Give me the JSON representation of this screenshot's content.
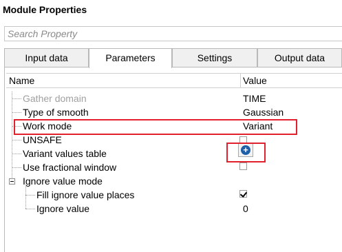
{
  "panel": {
    "title": "Module Properties"
  },
  "search": {
    "placeholder": "Search Property",
    "value": ""
  },
  "tabs": [
    {
      "label": "Input data",
      "active": false
    },
    {
      "label": "Parameters",
      "active": true
    },
    {
      "label": "Settings",
      "active": false
    },
    {
      "label": "Output data",
      "active": false
    }
  ],
  "grid": {
    "headers": {
      "name": "Name",
      "value": "Value"
    },
    "rows": [
      {
        "name": "Gather domain",
        "value": "TIME",
        "disabled": true
      },
      {
        "name": "Type of smooth",
        "value": "Gaussian"
      },
      {
        "name": "Work mode",
        "value": "Variant",
        "highlighted": true
      },
      {
        "name": "UNSAFE",
        "value_type": "checkbox",
        "checked": false
      },
      {
        "name": "Variant values table",
        "value_type": "add-button",
        "button_icon": "plus-icon",
        "highlighted": true
      },
      {
        "name": "Use fractional window",
        "value_type": "checkbox",
        "checked": false
      },
      {
        "name": "Ignore value mode",
        "group": true,
        "expanded": true
      },
      {
        "name": "Fill ignore value places",
        "value_type": "checkbox",
        "checked": true,
        "child": true
      },
      {
        "name": "Ignore value",
        "value": "0",
        "child": true
      }
    ]
  },
  "colors": {
    "highlight": "#e21f2b",
    "button_icon": "#1f5fa8"
  }
}
